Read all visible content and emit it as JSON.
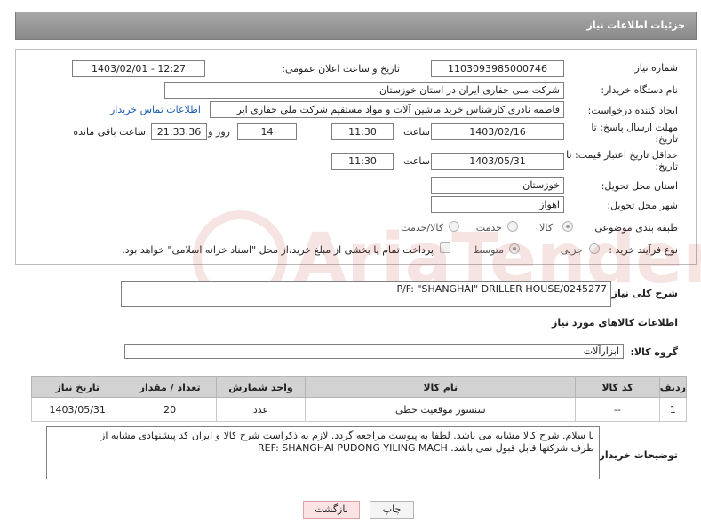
{
  "header": {
    "title": "جزئیات اطلاعات نیاز"
  },
  "form": {
    "need_number_label": "شماره نیاز:",
    "need_number": "1103093985000746",
    "announce_label": "تاریخ و ساعت اعلان عمومی:",
    "announce_value": "1403/02/01 - 12:27",
    "buyer_org_label": "نام دستگاه خریدار:",
    "buyer_org": "شرکت ملی حفاری ایران در استان خوزستان",
    "requester_label": "ایجاد کننده درخواست:",
    "requester": "فاطمه نادری کارشناس خرید ماشین آلات و مواد مستقیم شرکت ملی حفاری ایر",
    "contact_link": "اطلاعات تماس خریدار",
    "deadline_label_1": "مهلت ارسال پاسخ: تا",
    "deadline_label_2": "تاریخ:",
    "deadline_date": "1403/02/16",
    "time_label": "ساعت",
    "deadline_time": "11:30",
    "days_value": "14",
    "days_label": "روز و",
    "remaining_time": "21:33:36",
    "remaining_label": "ساعت باقی مانده",
    "validity_label_1": "حداقل تاریخ اعتبار قیمت: تا",
    "validity_label_2": "تاریخ:",
    "validity_date": "1403/05/31",
    "validity_time": "11:30",
    "province_label": "استان محل تحویل:",
    "province": "خوزستان",
    "city_label": "شهر محل تحویل:",
    "city": "اهواز",
    "category_label": "طبقه بندی موضوعی:",
    "category_options": [
      "کالا",
      "خدمت",
      "کالا/خدمت"
    ],
    "process_label": "نوع فرآیند خرید :",
    "process_options": [
      "جزیی",
      "متوسط"
    ],
    "payment_note": "پرداخت تمام یا بخشی از مبلغ خرید،از محل \"اسناد خزانه اسلامی\" خواهد بود."
  },
  "summary": {
    "label": "شرح کلی نیاز:",
    "value": "P/F: \"SHANGHAI\" DRILLER HOUSE/0245277"
  },
  "goods": {
    "section_title": "اطلاعات کالاهای مورد نیاز",
    "group_label": "گروه کالا:",
    "group_value": "ابزارآلات",
    "columns": [
      "ردیف",
      "کد کالا",
      "نام کالا",
      "واحد شمارش",
      "تعداد / مقدار",
      "تاریخ نیاز"
    ],
    "rows": [
      [
        "1",
        "--",
        "سنسور موقعیت خطی",
        "عدد",
        "20",
        "1403/05/31"
      ]
    ]
  },
  "buyer_notes": {
    "label": "توضیحات خریدار:",
    "line1": "با سلام. شرح کالا مشابه می باشد. لطفا به پیوست مراجعه گردد. لازم به ذکراست شرح کالا و ایران کد  پیشنهادی مشابه از",
    "line2": "طرف شرکتها قابل قبول نمی باشد. REF: SHANGHAI PUDONG YILING MACH"
  },
  "buttons": {
    "print": "چاپ",
    "back": "بازگشت"
  },
  "colors": {
    "header_bg": "#9a9a9a",
    "table_header_bg": "#d2d2d2",
    "link": "#1a5fb4",
    "back_btn_bg": "#fbe3e3"
  }
}
